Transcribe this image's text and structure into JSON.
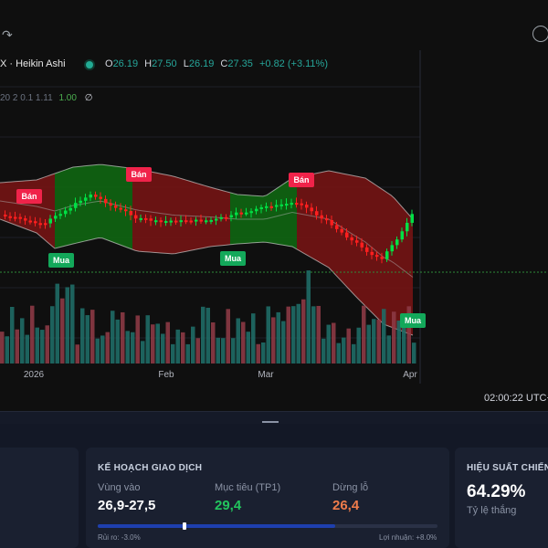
{
  "legend": {
    "symbol": "X · Heikin Ashi",
    "open_label": "O",
    "open": "26.19",
    "high_label": "H",
    "high": "27.50",
    "low_label": "L",
    "low": "26.19",
    "close_label": "C",
    "close": "27.35",
    "change": "+0.82 (+3.11%)",
    "indicator_params": "20 2 0.1 1.11",
    "indicator_value": "1.00",
    "indicator_extra": "∅"
  },
  "signals": [
    {
      "label": "Bán",
      "type": "sell"
    },
    {
      "label": "Mua",
      "type": "buy"
    },
    {
      "label": "Bán",
      "type": "sell"
    },
    {
      "label": "Mua",
      "type": "buy"
    },
    {
      "label": "Bán",
      "type": "sell"
    },
    {
      "label": "Mua",
      "type": "buy"
    }
  ],
  "x_axis": [
    "2026",
    "Feb",
    "Mar",
    "Apr"
  ],
  "time": "02:00:22 UTC+",
  "colors": {
    "up": "#00e045",
    "down": "#ff1f1f",
    "vol_up": "#1f6b66",
    "vol_down": "#8c3a45",
    "band_green": "#0f6b12",
    "band_red": "#7a1414",
    "sell_tag": "#f0234a",
    "buy_tag": "#13a85a"
  },
  "plan": {
    "title": "KẾ HOẠCH GIAO DỊCH",
    "entry_label": "Vùng vào",
    "entry_value": "26,9-27,5",
    "target_label": "Mục tiêu (TP1)",
    "target_value": "29,4",
    "stop_label": "Dừng lỗ",
    "stop_value": "26,4",
    "risk_text": "Rủi ro: -3.0%",
    "reward_text": "Lợi nhuận: +8.0%",
    "marker_ratio": 0.25,
    "fill_ratio": 0.7
  },
  "performance": {
    "title": "HIỆU SUẤT CHIẾN",
    "win_rate": "64.29%",
    "win_label": "Tỷ lệ thắng"
  }
}
